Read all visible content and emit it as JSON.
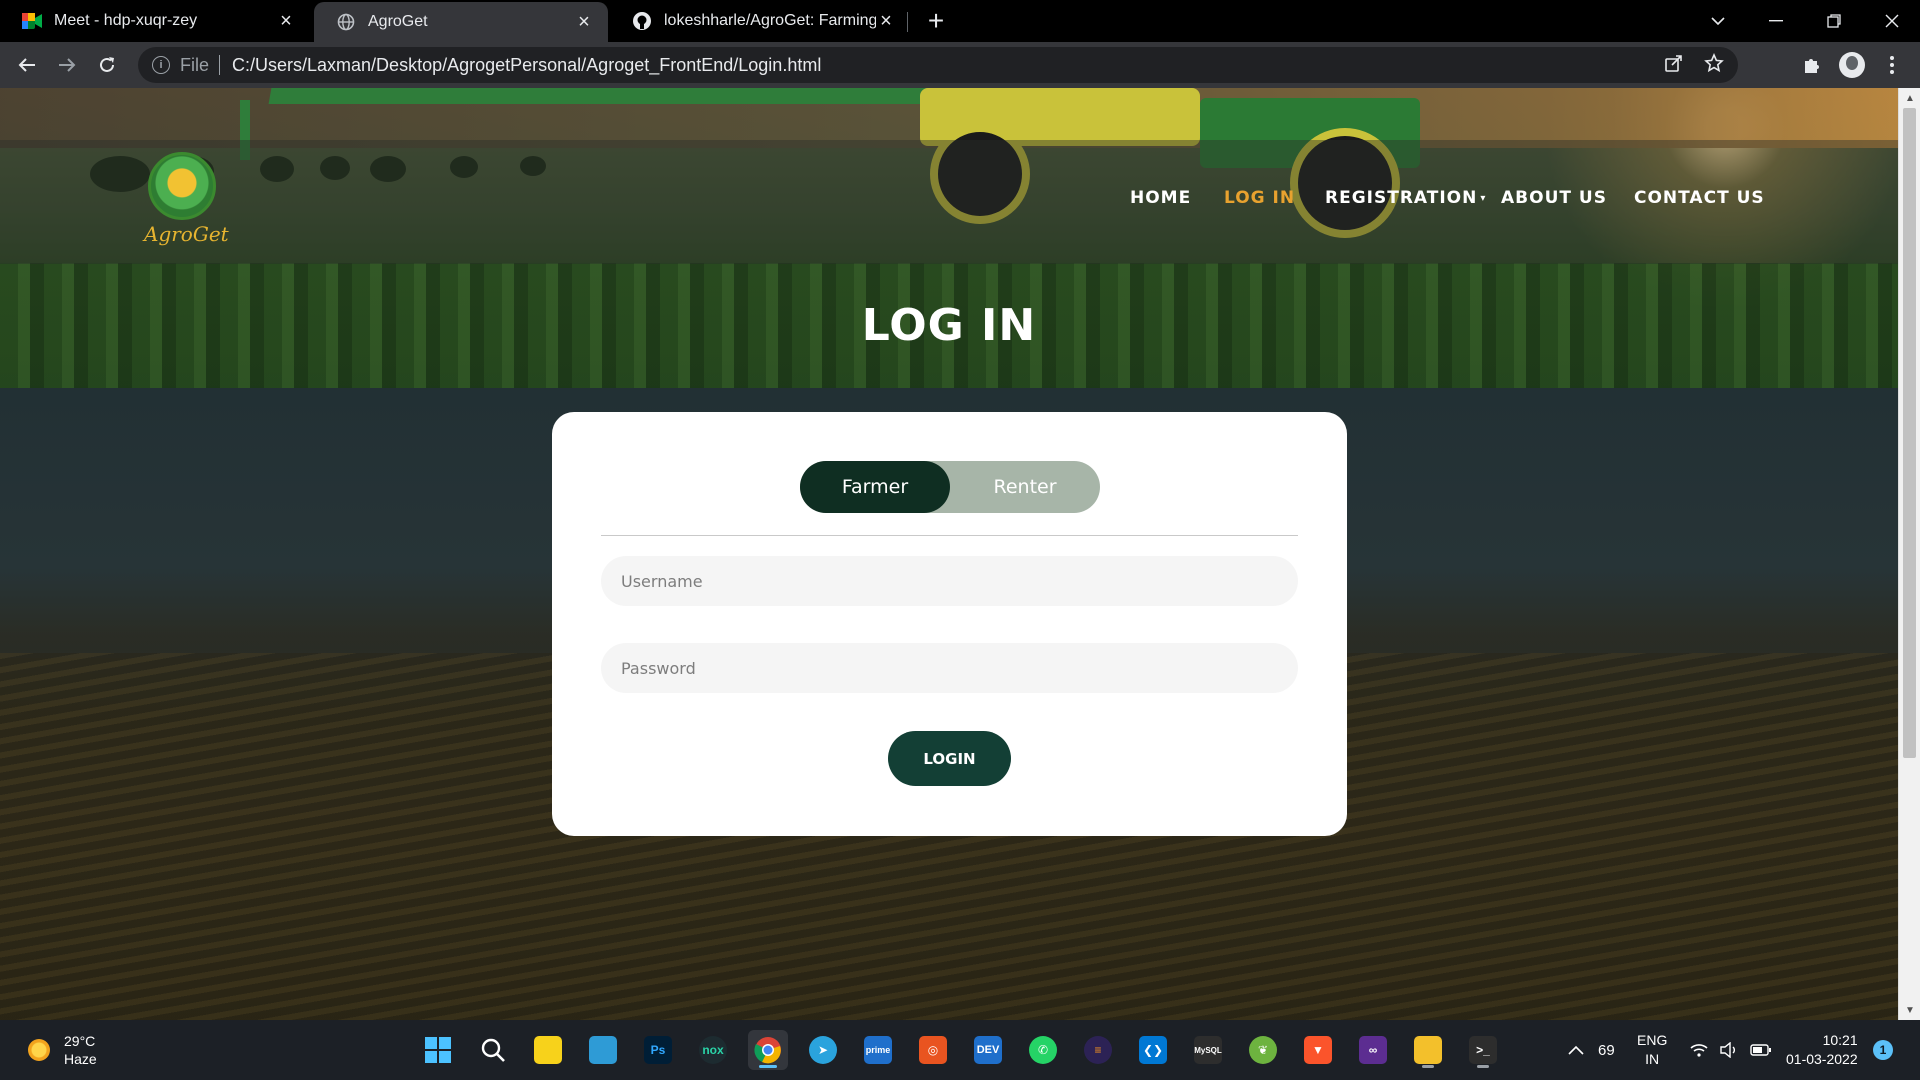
{
  "browser": {
    "tabs": [
      {
        "title": "Meet - hdp-xuqr-zey",
        "icon": "google-meet-icon",
        "active": false
      },
      {
        "title": "AgroGet",
        "icon": "globe-icon",
        "active": true
      },
      {
        "title": "lokeshharle/AgroGet: Farming Eq",
        "icon": "github-icon",
        "active": false
      }
    ],
    "address": {
      "scheme_label": "File",
      "url": "C:/Users/Laxman/Desktop/AgrogetPersonal/Agroget_FrontEnd/Login.html"
    }
  },
  "site": {
    "logo_text": "AgroGet",
    "nav": {
      "home": "HOME",
      "login": "LOG IN",
      "registration": "REGISTRATION",
      "about": "ABOUT US",
      "contact": "CONTACT US",
      "active": "LOG IN"
    },
    "page_title": "LOG IN"
  },
  "login_card": {
    "toggle": {
      "farmer": "Farmer",
      "renter": "Renter",
      "selected": "Farmer"
    },
    "username_placeholder": "Username",
    "password_placeholder": "Password",
    "submit_label": "LOGIN"
  },
  "taskbar": {
    "weather": {
      "temp": "29°C",
      "condition": "Haze"
    },
    "apps": [
      "windows-start-icon",
      "search-icon",
      "sticky-notes-icon",
      "desktop-icon",
      "photoshop-icon",
      "nox-icon",
      "chrome-icon",
      "telegram-icon",
      "prime-video-icon",
      "ubuntu-icon",
      "dev-icon",
      "whatsapp-icon",
      "eclipse-icon",
      "vscode-icon",
      "mysql-icon",
      "spring-icon",
      "brave-icon",
      "visual-studio-icon",
      "file-explorer-icon",
      "terminal-icon"
    ],
    "tray": {
      "badge_number": "69",
      "language": "ENG",
      "region": "IN",
      "time": "10:21",
      "date": "01-03-2022",
      "notifications": "1"
    }
  },
  "colors": {
    "accent": "#e8a22f",
    "toggle_active": "#0f2e22",
    "toggle_track": "#a7b5a8",
    "login_button": "#133f35"
  }
}
